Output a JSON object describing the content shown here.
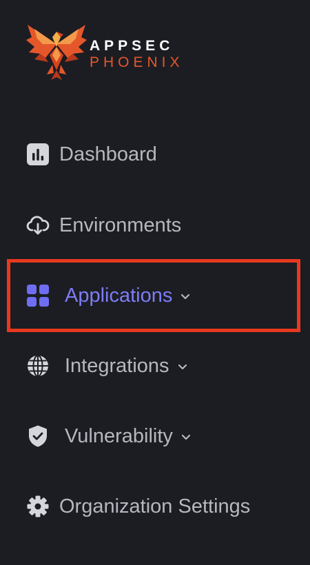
{
  "logo": {
    "line1": "APPSEC",
    "line2": "PHOENIX"
  },
  "nav": [
    {
      "label": "Dashboard",
      "icon": "bar-chart-icon",
      "has_chevron": false,
      "active": false
    },
    {
      "label": "Environments",
      "icon": "cloud-download-icon",
      "has_chevron": false,
      "active": false
    },
    {
      "label": "Applications",
      "icon": "grid-icon",
      "has_chevron": true,
      "active": true
    },
    {
      "label": "Integrations",
      "icon": "globe-icon",
      "has_chevron": true,
      "active": false
    },
    {
      "label": "Vulnerability",
      "icon": "shield-check-icon",
      "has_chevron": true,
      "active": false
    },
    {
      "label": "Organization Settings",
      "icon": "gear-icon",
      "has_chevron": false,
      "active": false
    }
  ],
  "colors": {
    "background": "#1c1d23",
    "active_accent": "#7d7cf6",
    "highlight_border": "#e8391f",
    "brand_orange": "#e5572b"
  }
}
